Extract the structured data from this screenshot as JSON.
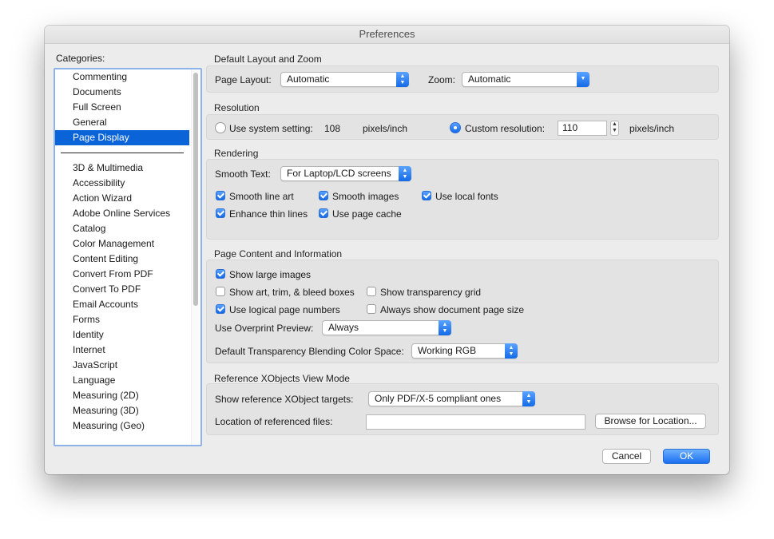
{
  "window": {
    "title": "Preferences"
  },
  "categories": {
    "label": "Categories:",
    "top_items": [
      "Commenting",
      "Documents",
      "Full Screen",
      "General",
      "Page Display"
    ],
    "selected": "Page Display",
    "items": [
      "3D & Multimedia",
      "Accessibility",
      "Action Wizard",
      "Adobe Online Services",
      "Catalog",
      "Color Management",
      "Content Editing",
      "Convert From PDF",
      "Convert To PDF",
      "Email Accounts",
      "Forms",
      "Identity",
      "Internet",
      "JavaScript",
      "Language",
      "Measuring (2D)",
      "Measuring (3D)",
      "Measuring (Geo)"
    ]
  },
  "layout_zoom": {
    "title": "Default Layout and Zoom",
    "page_layout_label": "Page Layout:",
    "page_layout_value": "Automatic",
    "zoom_label": "Zoom:",
    "zoom_value": "Automatic"
  },
  "resolution": {
    "title": "Resolution",
    "system_label": "Use system setting:",
    "system_value": "108",
    "system_unit": "pixels/inch",
    "custom_label": "Custom resolution:",
    "custom_value": "110",
    "custom_unit": "pixels/inch",
    "selected": "custom"
  },
  "rendering": {
    "title": "Rendering",
    "smooth_text_label": "Smooth Text:",
    "smooth_text_value": "For Laptop/LCD screens",
    "smooth_line_art": {
      "label": "Smooth line art",
      "checked": true
    },
    "smooth_images": {
      "label": "Smooth images",
      "checked": true
    },
    "use_local_fonts": {
      "label": "Use local fonts",
      "checked": true
    },
    "enhance_thin_lines": {
      "label": "Enhance thin lines",
      "checked": true
    },
    "use_page_cache": {
      "label": "Use page cache",
      "checked": true
    }
  },
  "page_content": {
    "title": "Page Content and Information",
    "show_large_images": {
      "label": "Show large images",
      "checked": true
    },
    "show_art_trim": {
      "label": "Show art, trim, & bleed boxes",
      "checked": false
    },
    "show_transparency_grid": {
      "label": "Show transparency grid",
      "checked": false
    },
    "use_logical_page_numbers": {
      "label": "Use logical page numbers",
      "checked": true
    },
    "always_show_page_size": {
      "label": "Always show document page size",
      "checked": false
    },
    "overprint_label": "Use Overprint Preview:",
    "overprint_value": "Always",
    "blending_label": "Default Transparency Blending Color Space:",
    "blending_value": "Working RGB"
  },
  "xobjects": {
    "title": "Reference XObjects View Mode",
    "targets_label": "Show reference XObject targets:",
    "targets_value": "Only PDF/X-5 compliant ones",
    "location_label": "Location of referenced files:",
    "location_value": "",
    "browse_label": "Browse for Location..."
  },
  "footer": {
    "cancel_label": "Cancel",
    "ok_label": "OK"
  },
  "colors": {
    "accent": "#0a64d8",
    "window_bg": "#ececec",
    "group_bg": "#e3e3e3"
  }
}
